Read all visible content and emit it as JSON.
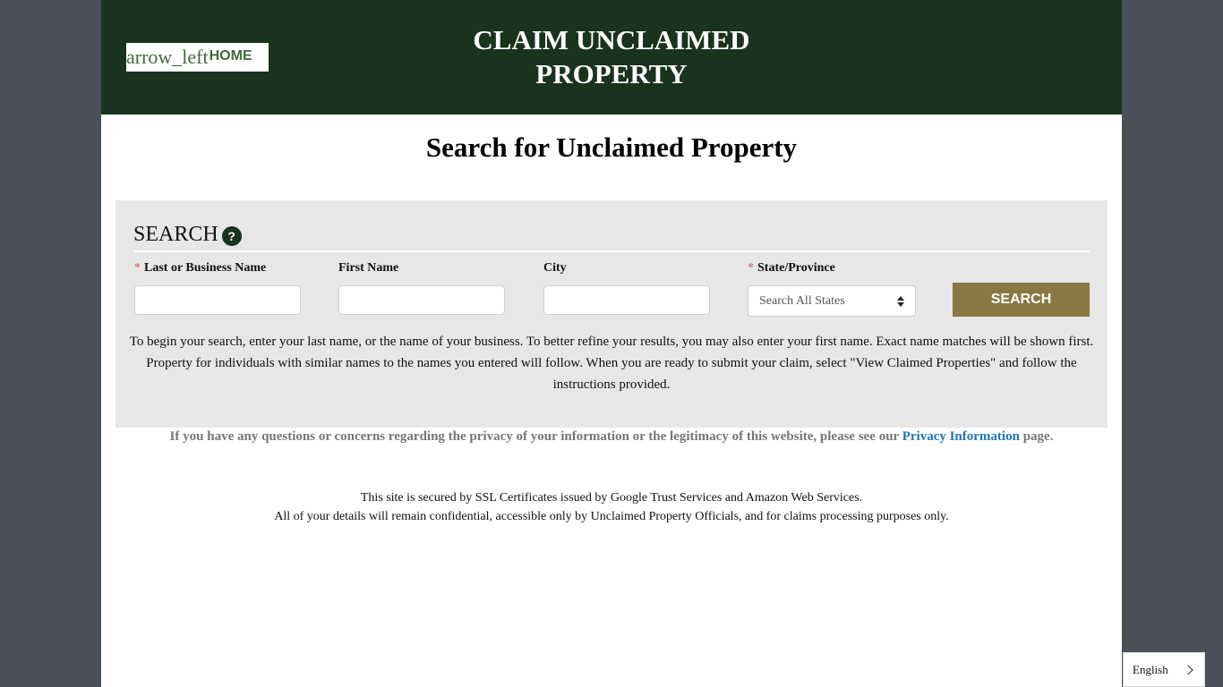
{
  "header": {
    "home_icon_text": "arrow_left",
    "home_label": "HOME",
    "title_line1": "CLAIM UNCLAIMED",
    "title_line2": "PROPERTY"
  },
  "main": {
    "heading": "Search for Unclaimed Property"
  },
  "search": {
    "title": "SEARCH",
    "help_symbol": "?",
    "required_marker": "*",
    "fields": {
      "last_name": {
        "label": "Last or Business Name",
        "value": "",
        "placeholder": ""
      },
      "first_name": {
        "label": "First Name",
        "value": "",
        "placeholder": ""
      },
      "city": {
        "label": "City",
        "value": "",
        "placeholder": ""
      },
      "state": {
        "label": "State/Province",
        "selected": "Search All States"
      }
    },
    "button_label": "SEARCH",
    "instructions": "To begin your search, enter your last name, or the name of your business.  To better refine your results, you may also enter your first name.  Exact name matches will be shown first.  Property for individuals with similar names to the names you entered will follow.  When you are ready to submit your claim, select \"View Claimed Properties\" and follow the instructions provided."
  },
  "privacy": {
    "text_before": "If you have any questions or concerns regarding the privacy of your information or the legitimacy of this website, please see our ",
    "link_text": "Privacy Information",
    "text_after": " page."
  },
  "footer": {
    "ssl_line1": "This site is secured by SSL Certificates issued by Google Trust Services and Amazon Web Services.",
    "ssl_line2": "All of your details will remain confidential, accessible only by Unclaimed Property Officials, and for claims processing purposes only."
  },
  "language": {
    "current": "English"
  },
  "colors": {
    "banner": "#19331c",
    "accent_button": "#8a7844",
    "link": "#1f76b8",
    "required": "#d9534f",
    "backdrop": "#4a4f59"
  }
}
